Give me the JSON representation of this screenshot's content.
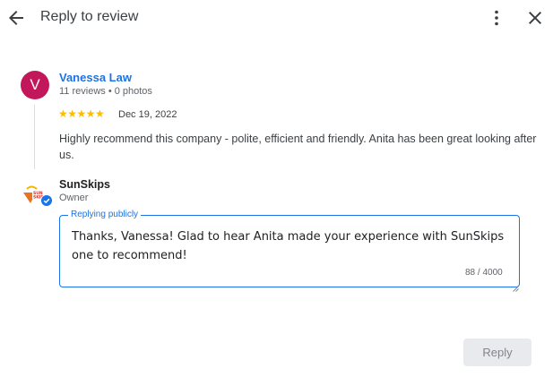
{
  "header": {
    "title": "Reply to review",
    "back_icon": "arrow-back-icon",
    "more_icon": "more-vert-icon",
    "close_icon": "close-icon"
  },
  "review": {
    "avatar_letter": "V",
    "avatar_color": "#c2185b",
    "reviewer_name": "Vanessa Law",
    "reviewer_meta": "11 reviews • 0 photos",
    "rating": 5,
    "stars": "★★★★★",
    "date": "Dec 19, 2022",
    "text": "Highly recommend this company - polite, efficient and friendly. Anita has been great looking after us."
  },
  "business": {
    "logo_text": "SUN SKIPS",
    "logo_icon": "sunskips-logo-icon",
    "verified_icon": "verified-check-icon",
    "name": "SunSkips",
    "role": "Owner"
  },
  "reply": {
    "legend": "Replying publicly",
    "value": "Thanks, Vanessa! Glad to hear Anita made your experience with SunSkips one to recommend!",
    "char_count": "88 / 4000"
  },
  "actions": {
    "reply_label": "Reply"
  },
  "colors": {
    "accent": "#1a73e8",
    "star": "#fbbc04",
    "disabled_button_bg": "#e8eaed"
  }
}
